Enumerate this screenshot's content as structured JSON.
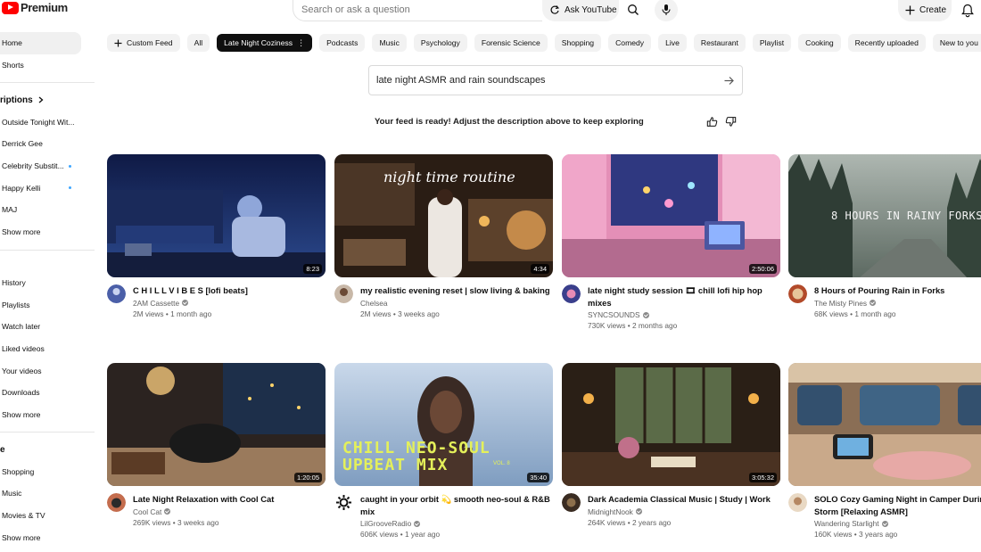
{
  "header": {
    "logo_text": "Premium",
    "search_placeholder": "Search or ask a question",
    "ask_label": "Ask YouTube",
    "create_label": "Create"
  },
  "sidebar": {
    "top": [
      {
        "label": "Home",
        "active": true
      },
      {
        "label": "Shorts"
      }
    ],
    "subscriptions_heading": "riptions",
    "subscriptions": [
      {
        "label": "Outside Tonight Wit...",
        "dot": false
      },
      {
        "label": "Derrick Gee",
        "dot": false
      },
      {
        "label": "Celebrity Substit...",
        "dot": true
      },
      {
        "label": "Happy Kelli",
        "dot": true
      },
      {
        "label": "MAJ",
        "dot": false
      },
      {
        "label": "Show more",
        "dot": false
      }
    ],
    "you": [
      {
        "label": "History"
      },
      {
        "label": "Playlists"
      },
      {
        "label": "Watch later"
      },
      {
        "label": "Liked videos"
      },
      {
        "label": "Your videos"
      },
      {
        "label": "Downloads"
      },
      {
        "label": "Show more"
      }
    ],
    "explore_heading": "e",
    "explore": [
      {
        "label": "Shopping"
      },
      {
        "label": "Music"
      },
      {
        "label": "Movies & TV"
      },
      {
        "label": "Show more"
      }
    ]
  },
  "chips": [
    {
      "label": "Custom Feed",
      "icon": "plus-icon"
    },
    {
      "label": "All"
    },
    {
      "label": "Late Night Coziness",
      "active": true,
      "icon": "kebab-icon"
    },
    {
      "label": "Podcasts"
    },
    {
      "label": "Music"
    },
    {
      "label": "Psychology"
    },
    {
      "label": "Forensic Science"
    },
    {
      "label": "Shopping"
    },
    {
      "label": "Comedy"
    },
    {
      "label": "Live"
    },
    {
      "label": "Restaurant"
    },
    {
      "label": "Playlist"
    },
    {
      "label": "Cooking"
    },
    {
      "label": "Recently uploaded"
    },
    {
      "label": "New to you"
    }
  ],
  "prompt": {
    "text": "late night ASMR and rain soundscapes",
    "feed_ready": "Your feed is ready! Adjust the description above to keep exploring"
  },
  "videos": [
    {
      "title": "C H I L L V I B E S [lofi beats]",
      "channel": "2AM Cassette",
      "verified": true,
      "stats": "2M views • 1 month ago",
      "duration": "8:23",
      "overlay": "",
      "colors": [
        "#1b2a5c",
        "#3d5aa8"
      ]
    },
    {
      "title": "my realistic evening reset | slow living & baking",
      "channel": "Chelsea",
      "verified": false,
      "stats": "2M views • 3 weeks ago",
      "duration": "4:34",
      "overlay": "night time routine",
      "colors": [
        "#2a1d14",
        "#8c6241"
      ]
    },
    {
      "title": "late night study session 🎞 chill lofi hip hop mixes",
      "channel": "SYNCSOUNDS",
      "verified": true,
      "stats": "730K views • 2 months ago",
      "duration": "2:50:06",
      "overlay": "",
      "colors": [
        "#3b3f8a",
        "#e88bb5"
      ]
    },
    {
      "title": "8 Hours of Pouring Rain in Forks",
      "channel": "The Misty Pines",
      "verified": true,
      "stats": "68K views • 1 month ago",
      "duration": "",
      "overlay": "8 HOURS IN RAINY FORKS",
      "colors": [
        "#4e5d54",
        "#9aa59c"
      ]
    },
    {
      "title": "Late Night Relaxation with Cool Cat",
      "channel": "Cool Cat",
      "verified": true,
      "stats": "269K views • 3 weeks ago",
      "duration": "1:20:05",
      "overlay": "",
      "colors": [
        "#2b2320",
        "#a07c5a"
      ]
    },
    {
      "title": "caught in your orbit 💫 smooth neo-soul & R&B mix",
      "channel": "LilGrooveRadio",
      "verified": true,
      "stats": "606K views • 1 year ago",
      "duration": "35:40",
      "overlay": "CHILL NEO-SOUL UPBEAT MIX",
      "overlay_sub": "VOL. 8",
      "colors": [
        "#8ea9c9",
        "#c9d8ea"
      ]
    },
    {
      "title": "Dark Academia Classical Music | Study | Work",
      "channel": "MidnightNook",
      "verified": true,
      "stats": "264K views • 2 years ago",
      "duration": "3:05:32",
      "overlay": "",
      "colors": [
        "#2a1f16",
        "#5b6b48"
      ]
    },
    {
      "title": "SOLO Cozy Gaming Night in Camper During Storm [Relaxing ASMR]",
      "channel": "Wandering Starlight",
      "verified": true,
      "stats": "160K views • 3 years ago",
      "duration": "",
      "overlay": "",
      "colors": [
        "#6b5a48",
        "#c7a88a"
      ]
    }
  ]
}
